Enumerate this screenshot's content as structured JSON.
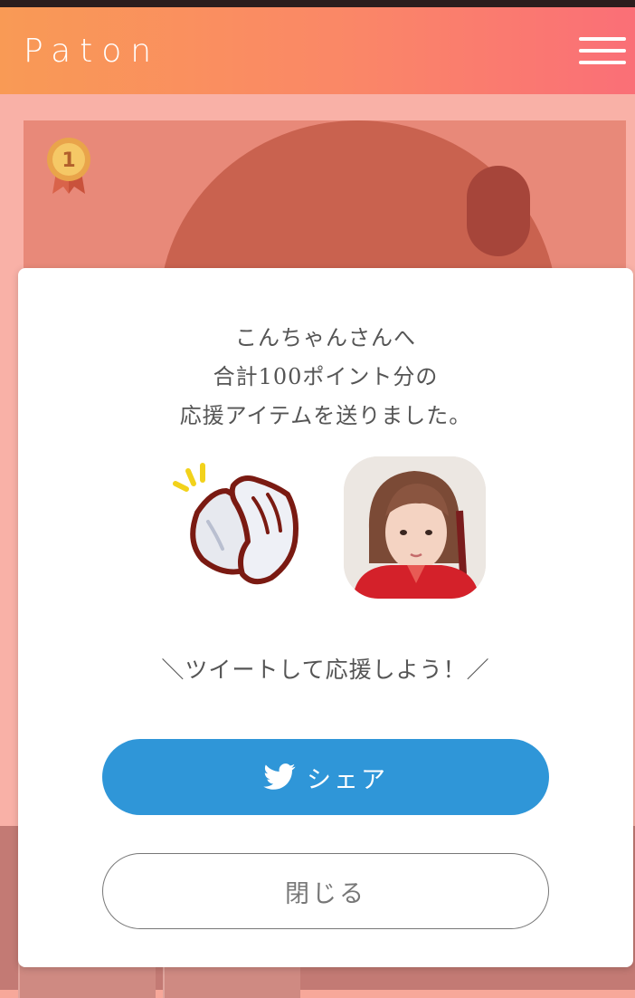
{
  "app": {
    "logo_text": "Paton"
  },
  "header": {
    "menu_icon": "hamburger-menu-icon"
  },
  "card": {
    "rank_badge": "1"
  },
  "modal": {
    "message_lines": [
      "こんちゃんさんへ",
      "合計100ポイント分の",
      "応援アイテムを送りました。"
    ],
    "item_icon": "clapping-hands-icon",
    "recipient_avatar": "recipient-photo",
    "tweet_prompt": "＼ツイートして応援しよう！／",
    "share_button": {
      "label": "シェア",
      "icon": "twitter-bird-icon"
    },
    "close_button": {
      "label": "閉じる"
    }
  },
  "colors": {
    "header_gradient_start": "#f99a55",
    "header_gradient_end": "#fa6f77",
    "share_button": "#2f96d8",
    "overlay": "#f7a89a"
  }
}
